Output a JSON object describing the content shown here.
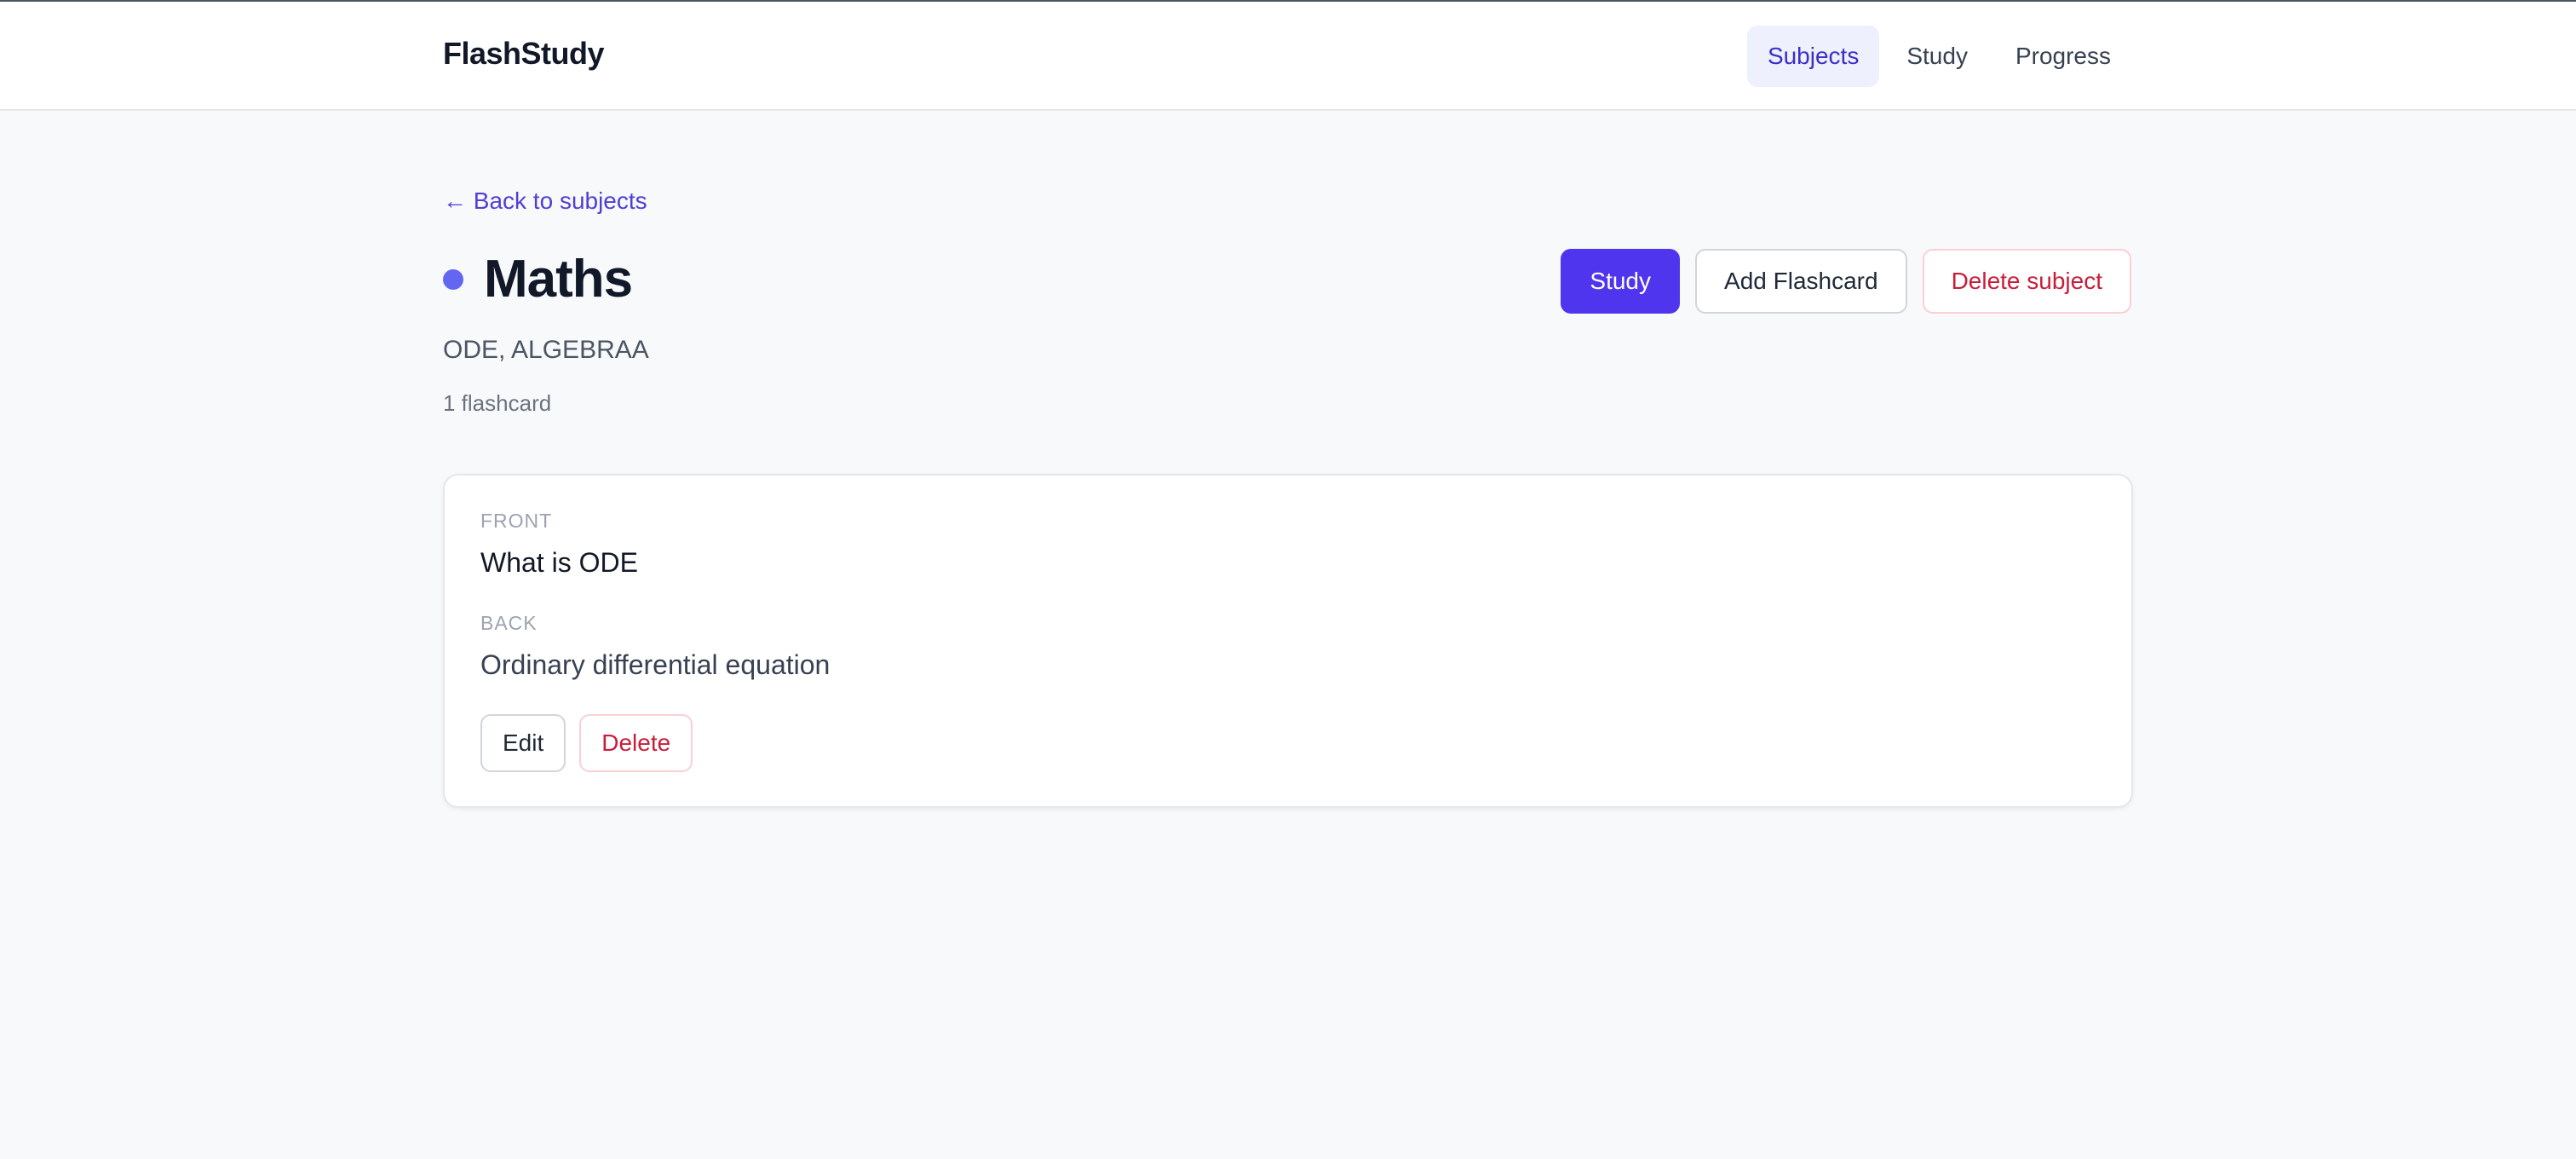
{
  "app": {
    "brand": "FlashStudy"
  },
  "nav": {
    "items": [
      {
        "label": "Subjects",
        "active": true
      },
      {
        "label": "Study",
        "active": false
      },
      {
        "label": "Progress",
        "active": false
      }
    ]
  },
  "page": {
    "back_link": "← Back to subjects",
    "title": "Maths",
    "description": "ODE, ALGEBRAA",
    "count": "1 flashcard",
    "actions": {
      "study": "Study",
      "add_flashcard": "Add Flashcard",
      "delete_subject": "Delete subject"
    }
  },
  "flashcards": [
    {
      "front_label": "FRONT",
      "front": "What is ODE",
      "back_label": "BACK",
      "back": "Ordinary differential equation",
      "edit_label": "Edit",
      "delete_label": "Delete"
    }
  ],
  "colors": {
    "accent": "#4f35ee",
    "subject_dot": "#6366f1",
    "danger": "#c81e3a",
    "nav_active_bg": "#eef0fd"
  }
}
